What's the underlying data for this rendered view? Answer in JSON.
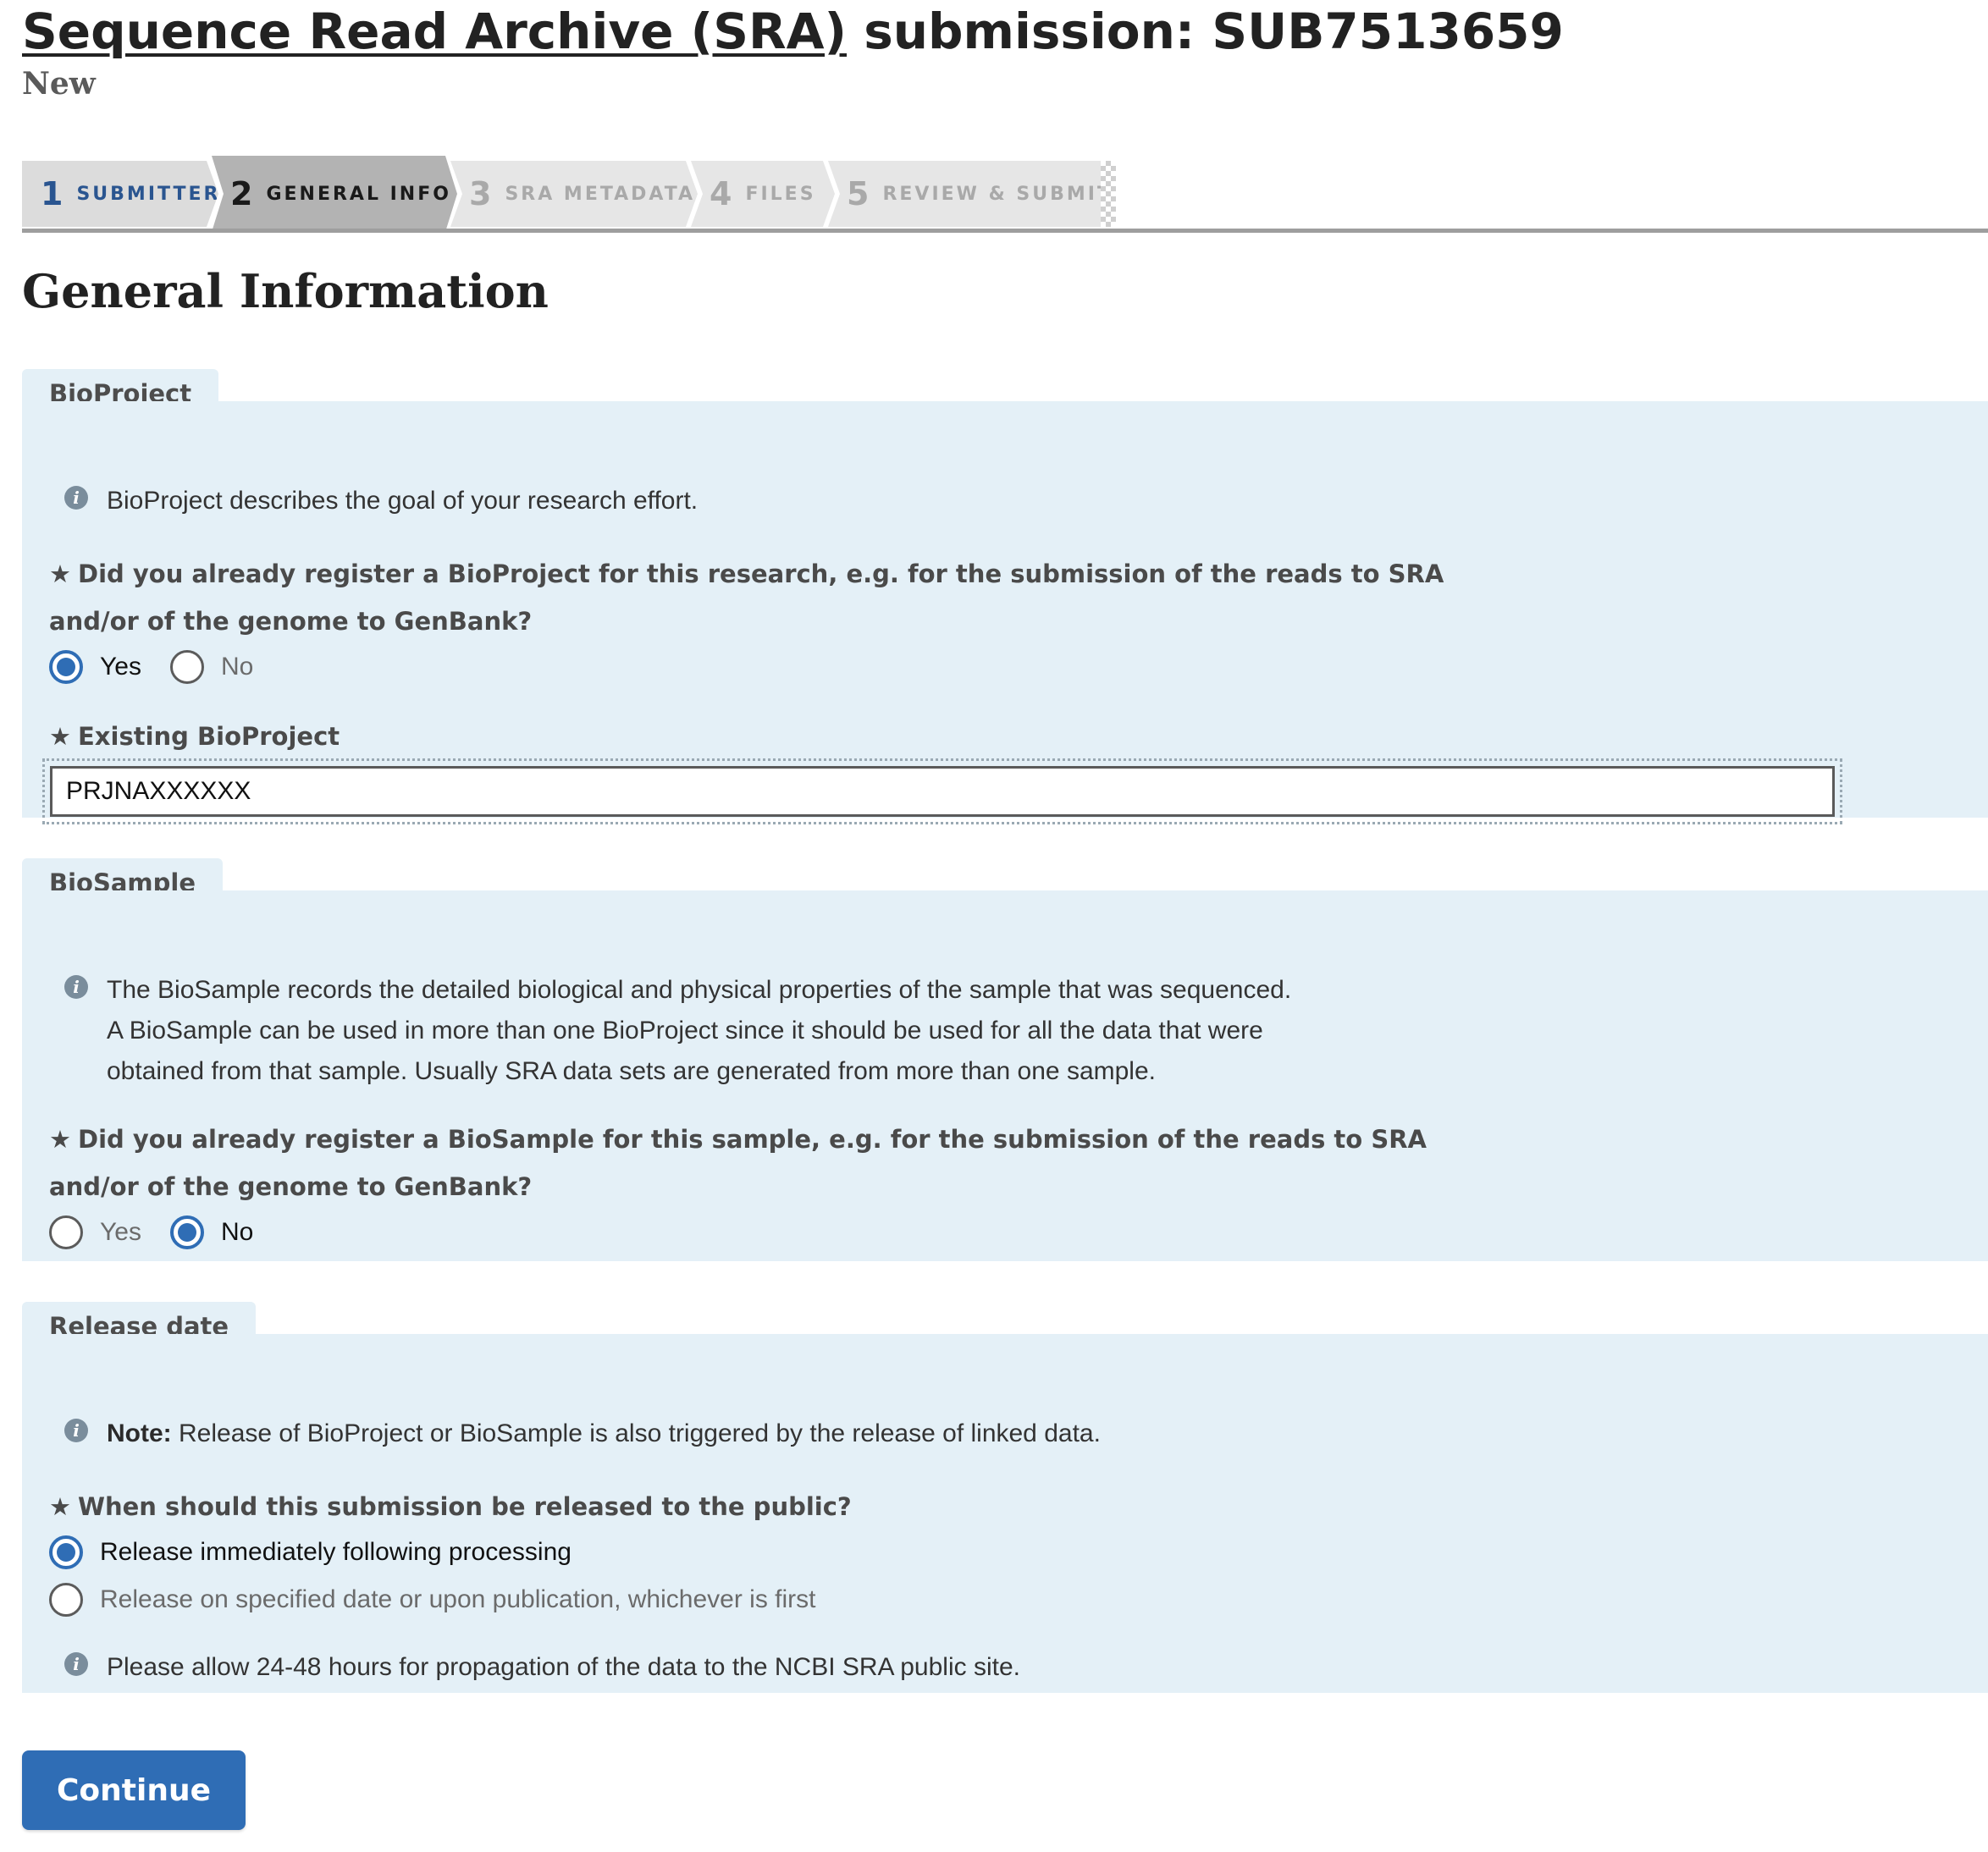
{
  "header": {
    "title_link": "Sequence Read Archive (SRA)",
    "title_rest": " submission: SUB7513659",
    "status": "New"
  },
  "stepper": {
    "steps": [
      {
        "num": "1",
        "label": "SUBMITTER",
        "state": "done"
      },
      {
        "num": "2",
        "label": "GENERAL INFO",
        "state": "active"
      },
      {
        "num": "3",
        "label": "SRA METADATA",
        "state": "todo"
      },
      {
        "num": "4",
        "label": "FILES",
        "state": "todo"
      },
      {
        "num": "5",
        "label": "REVIEW & SUBMIT",
        "state": "todo"
      }
    ]
  },
  "section_title": "General Information",
  "bioproject": {
    "tab": "BioProject",
    "info_icon": "info-icon",
    "info": "BioProject describes the goal of your research effort.",
    "question_line1": "Did you already register a BioProject for this research, e.g. for the submission of the reads to SRA",
    "question_line2": "and/or of the genome to GenBank?",
    "options": [
      "Yes",
      "No"
    ],
    "selected": "Yes",
    "field_label": "Existing BioProject",
    "field_value": "PRJNAXXXXXX"
  },
  "biosample": {
    "tab": "BioSample",
    "info_line1": "The BioSample records the detailed biological and physical properties of the sample that was sequenced.",
    "info_line2": "A BioSample can be used in more than one BioProject since it should be used for all the data that were",
    "info_line3": "obtained from that sample. Usually SRA data sets are generated from more than one sample.",
    "question_line1": "Did you already register a BioSample for this sample, e.g. for the submission of the reads to SRA",
    "question_line2": "and/or of the genome to GenBank?",
    "options": [
      "Yes",
      "No"
    ],
    "selected": "No"
  },
  "release": {
    "tab": "Release date",
    "note_label": "Note:",
    "note_text": " Release of BioProject or BioSample is also triggered by the release of linked data.",
    "question": "When should this submission be released to the public?",
    "option_immediate": "Release immediately following processing",
    "option_specified": "Release on specified date or upon publication, whichever is first",
    "selected": "Release immediately following processing",
    "footer_info": "Please allow 24-48 hours for propagation of the data to the NCBI SRA public site."
  },
  "actions": {
    "continue_label": "Continue"
  },
  "colors": {
    "accent": "#2f6db5",
    "panel_bg": "#e4f0f7",
    "step_done_text": "#2a5590"
  }
}
